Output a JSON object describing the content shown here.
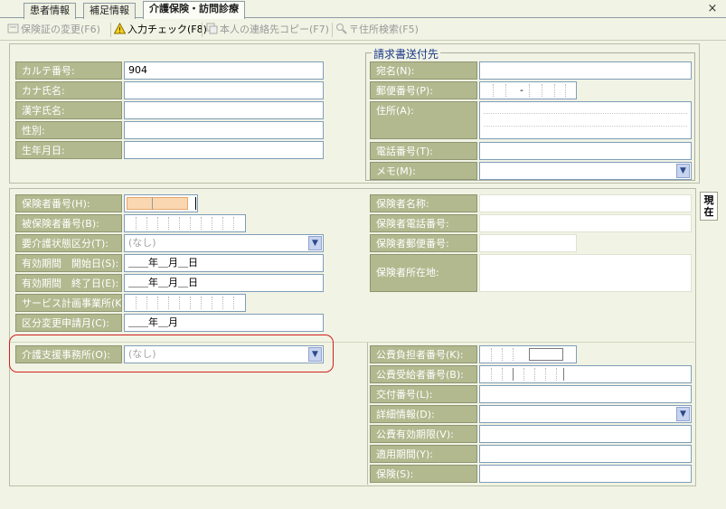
{
  "tabs": [
    {
      "label": "患者情報"
    },
    {
      "label": "補足情報"
    },
    {
      "label": "介護保険・訪問診療",
      "active": true
    }
  ],
  "toolbar": {
    "change_insurance": "保険証の変更(F6)",
    "input_check": "入力チェック(F8)",
    "copy_contact": "本人の連絡先コピー(F7)",
    "address_search": "〒住所検索(F5)"
  },
  "patient": {
    "chart_no_label": "カルテ番号:",
    "chart_no_value": "904",
    "kana_label": "カナ氏名:",
    "kanji_label": "漢字氏名:",
    "sex_label": "性別:",
    "dob_label": "生年月日:"
  },
  "billing": {
    "title": "請求書送付先",
    "addressee_label": "宛名(N):",
    "postal_label": "郵便番号(P):",
    "postal_sep": "-",
    "address_label": "住所(A):",
    "phone_label": "電話番号(T):",
    "memo_label": "メモ(M):"
  },
  "care": {
    "insurer_no_label": "保険者番号(H):",
    "insured_no_label": "被保険者番号(B):",
    "care_level_label": "要介護状態区分(T):",
    "care_level_value": "(なし)",
    "valid_start_label": "有効期間　開始日(S):",
    "valid_start_value": "＿＿年＿月＿日",
    "valid_end_label": "有効期間　終了日(E):",
    "valid_end_value": "＿＿年＿月＿日",
    "service_plan_label": "サービス計画事業所(K):",
    "change_request_label": "区分変更申請月(C):",
    "change_request_value": "＿＿年＿月",
    "support_office_label": "介護支援事務所(O):",
    "support_office_value": "(なし)"
  },
  "insurer": {
    "name_label": "保険者名称:",
    "phone_label": "保険者電話番号:",
    "postal_label": "保険者郵便番号:",
    "address_label": "保険者所在地:"
  },
  "public_expense": {
    "payer_no_label": "公費負担者番号(K):",
    "recipient_no_label": "公費受給者番号(B):",
    "issue_no_label": "交付番号(L):",
    "details_label": "詳細情報(D):",
    "valid_label": "公費有効期限(V):",
    "period_label": "適用期間(Y):",
    "insurance_label": "保険(S):"
  },
  "side_tab": {
    "label": "現在"
  },
  "colors": {
    "label_bg": "#b3b98f",
    "panel_bg": "#f1f3e4",
    "title_blue": "#1b3a8a",
    "highlight": "#d12020"
  }
}
